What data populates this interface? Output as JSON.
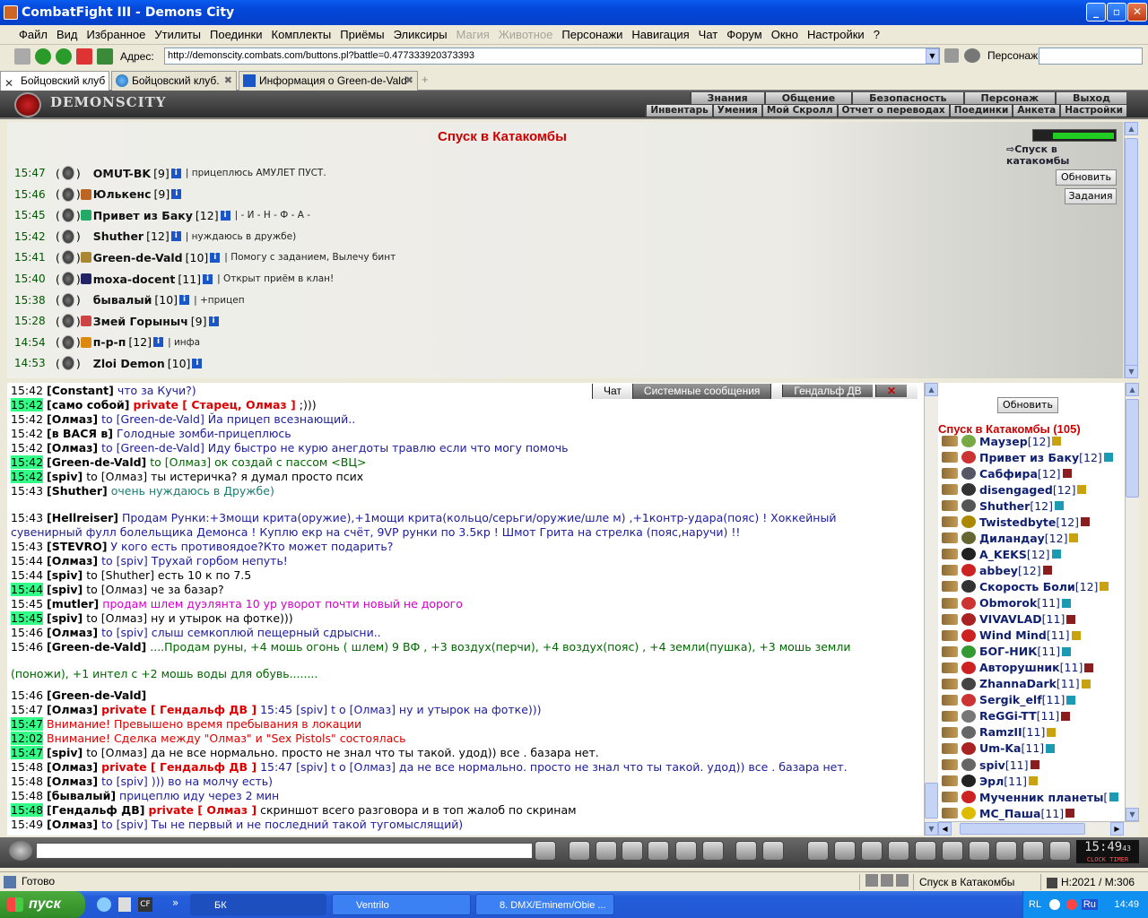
{
  "window": {
    "title": "CombatFight III - Demons City",
    "min": "_",
    "max": "▫",
    "close": "✕"
  },
  "menu": [
    "Файл",
    "Вид",
    "Избранное",
    "Утилиты",
    "Поединки",
    "Комплекты",
    "Приёмы",
    "Эликсиры",
    "Магия",
    "Животное",
    "Персонажи",
    "Навигация",
    "Чат",
    "Форум",
    "Окно",
    "Настройки",
    "?"
  ],
  "toolbar": {
    "address_label": "Адрес:",
    "address": "http://demonscity.combats.com/buttons.pl?battle=0.477333920373393",
    "person_label": "Персонаж:"
  },
  "tabs": [
    {
      "label": "Бойцовский клуб"
    },
    {
      "label": "Бойцовский клуб."
    },
    {
      "label": "Информация о Green-de-Vald"
    }
  ],
  "game": {
    "logo": "DEMONSCITY",
    "nav_top": [
      "Знания",
      "Общение",
      "Безопасность",
      "Персонаж",
      "Выход"
    ],
    "nav_bottom": [
      "Инвентарь",
      "Умения",
      "Мой Скролл",
      "Отчет о переводах",
      "Поединки",
      "Анкета",
      "Настройки"
    ]
  },
  "room": {
    "title": "Спуск в Катакомбы",
    "link": "Спуск в катакомбы",
    "refresh": "Обновить",
    "tasks": "Задания",
    "players": [
      {
        "time": "15:47",
        "name": "OMUT-BK",
        "level": "[9]",
        "status": "прицеплюсь АМУЛЕТ ПУСТ."
      },
      {
        "time": "15:46",
        "name": "Юлькенс",
        "level": "[9]",
        "status": ""
      },
      {
        "time": "15:45",
        "name": "Привет из Баку",
        "level": "[12]",
        "status": "- И - Н - Ф - А -"
      },
      {
        "time": "15:42",
        "name": "Shuther",
        "level": "[12]",
        "status": "нуждаюсь в дружбе)"
      },
      {
        "time": "15:41",
        "name": "Green-de-Vald",
        "level": "[10]",
        "status": "Помогу с заданием, Вылечу бинт"
      },
      {
        "time": "15:40",
        "name": "moxa-docent",
        "level": "[11]",
        "status": "Открыт приём в клан!"
      },
      {
        "time": "15:38",
        "name": "бывалый",
        "level": "[10]",
        "status": "+прицеп"
      },
      {
        "time": "15:28",
        "name": "Змей Горыныч",
        "level": "[9]",
        "status": ""
      },
      {
        "time": "14:54",
        "name": "п-р-п",
        "level": "[12]",
        "status": "инфа"
      },
      {
        "time": "14:53",
        "name": "Zloi Demon",
        "level": "[10]",
        "status": ""
      }
    ]
  },
  "chat_tabs": [
    "Чат",
    "Системные сообщения",
    "Гендальф ДВ"
  ],
  "chat": [
    {
      "time": "15:42",
      "hl": false,
      "who": "[Constant]",
      "bold": false,
      "priv": "",
      "rest": "что за Кучи?)",
      "cls": "blue"
    },
    {
      "time": "15:42",
      "hl": true,
      "who": "[само собой]",
      "bold": true,
      "priv": "private [ Старец, Олмаз ]",
      "rest": ";)))",
      "cls": "dark"
    },
    {
      "time": "15:42",
      "hl": false,
      "who": "[Олмаз]",
      "bold": true,
      "priv": "",
      "rest": "to [Green-de-Vald] Йа прицеп всезнающий..",
      "cls": "blue"
    },
    {
      "time": "15:42",
      "hl": false,
      "who": "[в ВАСЯ в]",
      "bold": true,
      "priv": "",
      "rest": "Голодные зомби-прицеплюсь",
      "cls": "blue"
    },
    {
      "time": "15:42",
      "hl": false,
      "who": "[Олмаз]",
      "bold": true,
      "priv": "",
      "rest": "to [Green-de-Vald] Иду быстро не курю анегдоты травлю если что могу помочь",
      "cls": "blue"
    },
    {
      "time": "15:42",
      "hl": true,
      "who": "[Green-de-Vald]",
      "bold": true,
      "priv": "",
      "rest": "to [Олмаз] ок создай с пассом <ВЦ>",
      "cls": "green"
    },
    {
      "time": "15:42",
      "hl": true,
      "who": "[spiv]",
      "bold": true,
      "priv": "",
      "rest": "to [Олмаз] ты истеричка? я думал просто псих",
      "cls": "dark"
    },
    {
      "time": "15:43",
      "hl": false,
      "who": "[Shuther]",
      "bold": true,
      "priv": "",
      "rest": "очень нуждаюсь в Дружбе)",
      "cls": "teal"
    },
    {
      "time": "15:43",
      "hl": false,
      "who": "[Hellreiser]",
      "bold": true,
      "priv": "",
      "rest": "Продам Рунки:+3мощи крита(оружие),+1мощи крита(кольцо/серьги/оружие/шле м) ,+1контр-удара(пояс) ! Хоккейный",
      "cls": "blue"
    },
    {
      "time": "",
      "hl": false,
      "who": "",
      "bold": false,
      "priv": "",
      "rest": "сувенирный фулл болельщика Демонса ! Куплю екр на счёт, 9VP рунки по 3.5кр ! Шмот Грита на стрелка (пояс,наручи) !!",
      "cls": "blue"
    },
    {
      "time": "15:43",
      "hl": false,
      "who": "[STEVRO]",
      "bold": true,
      "priv": "",
      "rest": "У кого есть противоядое?Кто может подарить?",
      "cls": "blue"
    },
    {
      "time": "15:44",
      "hl": false,
      "who": "[Олмаз]",
      "bold": true,
      "priv": "",
      "rest": "to [spiv] Трухай горбом непуть!",
      "cls": "blue"
    },
    {
      "time": "15:44",
      "hl": false,
      "who": "[spiv]",
      "bold": true,
      "priv": "",
      "rest": "to [Shuther] есть 10 к по 7.5",
      "cls": "dark"
    },
    {
      "time": "15:44",
      "hl": true,
      "who": "[spiv]",
      "bold": true,
      "priv": "",
      "rest": "to [Олмаз] че за базар?",
      "cls": "dark"
    },
    {
      "time": "15:45",
      "hl": false,
      "who": "[mutler]",
      "bold": true,
      "priv": "",
      "rest": "продам шлем дуэлянта 10 ур уворот почти новый не дорого",
      "cls": "magenta"
    },
    {
      "time": "15:45",
      "hl": true,
      "who": "[spiv]",
      "bold": true,
      "priv": "",
      "rest": "to [Олмаз] ну и утырок на фотке)))",
      "cls": "dark"
    },
    {
      "time": "15:46",
      "hl": false,
      "who": "[Олмаз]",
      "bold": true,
      "priv": "",
      "rest": "to [spiv] слыш семкоплюй пещерный сдрысни..",
      "cls": "blue"
    },
    {
      "time": "15:46",
      "hl": false,
      "who": "[Green-de-Vald]",
      "bold": true,
      "priv": "",
      "rest": "....Продам руны, +4 мошь огонь ( шлем) 9 ВФ , +3 воздух(перчи), +4 воздух(пояс) , +4 земли(пушка), +3 мошь земли",
      "cls": "green"
    },
    {
      "time": "",
      "hl": false,
      "who": "",
      "bold": false,
      "priv": "",
      "rest": "(поножи), +1 интел с +2 мошь воды для обувь........",
      "cls": "green"
    },
    {
      "time": "15:46",
      "hl": false,
      "who": "[Green-de-Vald]",
      "bold": true,
      "priv": "",
      "rest": "",
      "cls": "green"
    },
    {
      "time": "15:47",
      "hl": false,
      "who": "[Олмаз]",
      "bold": true,
      "priv": "private [ Гендальф ДВ ]",
      "rest": "15:45 [spiv] t o [Олмаз] ну и утырок на фотке)))",
      "cls": "blue"
    },
    {
      "time": "15:47",
      "hl": true,
      "who": "",
      "bold": false,
      "priv": "",
      "rest": "Внимание! Превышено время пребывания в локации",
      "cls": "sys"
    },
    {
      "time": "12:02",
      "hl": true,
      "who": "",
      "bold": false,
      "priv": "",
      "rest": "Внимание! Сделка между \"Олмаз\" и \"Sex Pistols\" состоялась",
      "cls": "sys"
    },
    {
      "time": "15:47",
      "hl": true,
      "who": "[spiv]",
      "bold": true,
      "priv": "",
      "rest": "to [Олмаз] да не все нормально. просто не знал что ты такой. удод)) все . базара нет.",
      "cls": "dark"
    },
    {
      "time": "15:48",
      "hl": false,
      "who": "[Олмаз]",
      "bold": true,
      "priv": "private [ Гендальф ДВ ]",
      "rest": "15:47 [spiv] t o [Олмаз] да не все нормально. просто не знал что ты такой. удод)) все . базара нет.",
      "cls": "blue"
    },
    {
      "time": "15:48",
      "hl": false,
      "who": "[Олмаз]",
      "bold": true,
      "priv": "",
      "rest": "to [spiv] ))) во на молчу есть)",
      "cls": "blue"
    },
    {
      "time": "15:48",
      "hl": false,
      "who": "[бывалый]",
      "bold": true,
      "priv": "",
      "rest": "прицеплю иду через 2 мин",
      "cls": "blue"
    },
    {
      "time": "15:48",
      "hl": true,
      "who": "[Гендальф ДВ]",
      "bold": true,
      "priv": "private [ Олмаз ]",
      "rest": "скриншот всего разговора и в топ жалоб по скринам",
      "cls": "dark"
    },
    {
      "time": "15:49",
      "hl": false,
      "who": "[Олмаз]",
      "bold": true,
      "priv": "",
      "rest": "to [spiv] Ты не первый и не последний такой тугомыслящий)",
      "cls": "blue"
    }
  ],
  "list": {
    "refresh": "Обновить",
    "header": "Спуск в Катакомбы (105)",
    "users": [
      {
        "name": "Маузер",
        "level": "[12]"
      },
      {
        "name": "Привет из Баку",
        "level": "[12]"
      },
      {
        "name": "Сабфира",
        "level": "[12]"
      },
      {
        "name": "disengaged",
        "level": "[12]"
      },
      {
        "name": "Shuther",
        "level": "[12]"
      },
      {
        "name": "Twistedbyte",
        "level": "[12]"
      },
      {
        "name": "Диландау",
        "level": "[12]"
      },
      {
        "name": "A_KEKS",
        "level": "[12]"
      },
      {
        "name": "abbey",
        "level": "[12]"
      },
      {
        "name": "Скорость Боли",
        "level": "[12]"
      },
      {
        "name": "Obmorok",
        "level": "[11]"
      },
      {
        "name": "VIVAVLAD",
        "level": "[11]"
      },
      {
        "name": "Wind Mind",
        "level": "[11]"
      },
      {
        "name": "БОГ-НИК",
        "level": "[11]"
      },
      {
        "name": "Авторушник",
        "level": "[11]"
      },
      {
        "name": "ZhannaDark",
        "level": "[11]"
      },
      {
        "name": "Sergik_elf",
        "level": "[11]"
      },
      {
        "name": "ReGGi-TT",
        "level": "[11]"
      },
      {
        "name": "RamzII",
        "level": "[11]"
      },
      {
        "name": "Um-Ka",
        "level": "[11]"
      },
      {
        "name": "spiv",
        "level": "[11]"
      },
      {
        "name": "Эрл",
        "level": "[11]"
      },
      {
        "name": "Мученник планеты",
        "level": "["
      },
      {
        "name": "MC_Паша",
        "level": "[11]"
      }
    ]
  },
  "clock": {
    "time": "15:49",
    "sec": "43",
    "label": "CLOCK TIMER"
  },
  "status": {
    "ready": "Готово",
    "location": "Спуск в Катакомбы",
    "hp": "H:2021 / M:306"
  },
  "taskbar": {
    "start": "пуск",
    "items": [
      "БК",
      "Ventrilo",
      "8. DMX/Eminem/Obie ..."
    ],
    "lang": "RL",
    "lang2": "Ru",
    "time": "14:49"
  }
}
